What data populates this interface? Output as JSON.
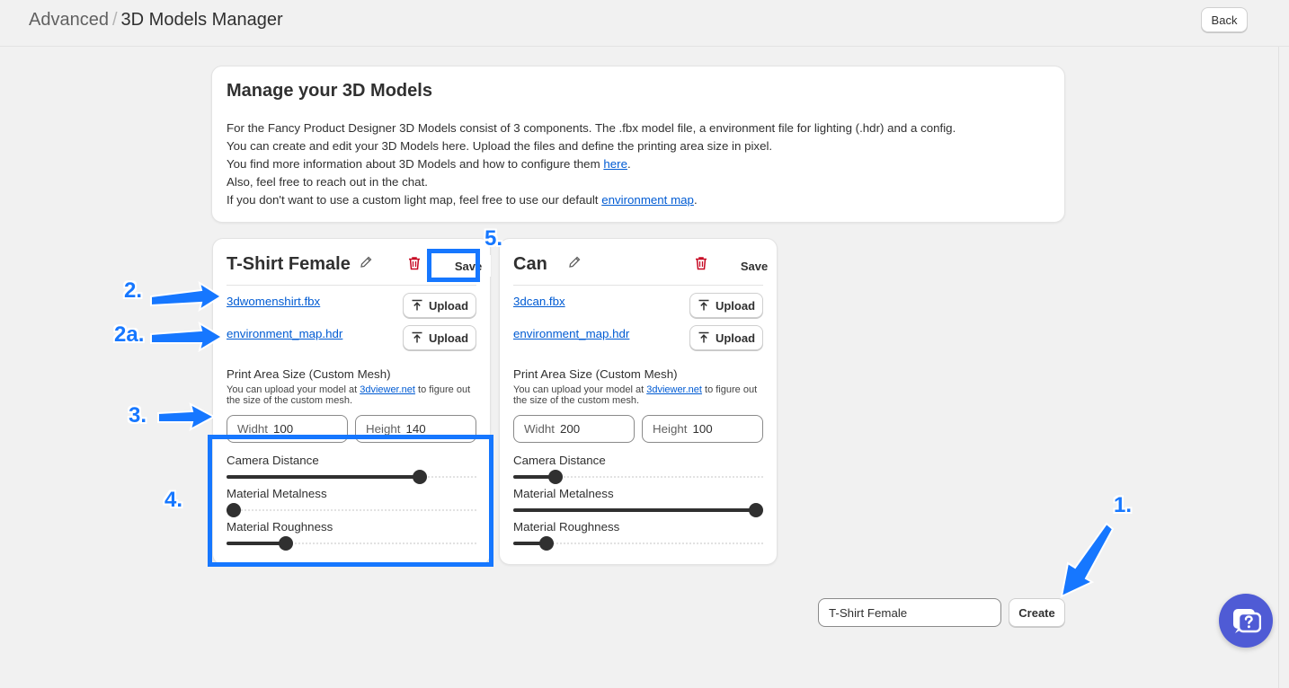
{
  "header": {
    "breadcrumb_parent": "Advanced",
    "breadcrumb_sep": "/",
    "breadcrumb_current": "3D Models Manager",
    "back_label": "Back"
  },
  "intro": {
    "title": "Manage your 3D Models",
    "line1": "For the Fancy Product Designer 3D Models consist of 3 components. The .fbx model file, a environment file for lighting (.hdr) and a config.",
    "line2": "You can create and edit your 3D Models here. Upload the files and define the printing area size in pixel.",
    "line3_pre": "You find more information about 3D Models and how to configure them ",
    "line3_link": "here",
    "line3_post": ".",
    "line4": "Also, feel free to reach out in the chat.",
    "line5_pre": "If you don't want to use a custom light map, feel free to use our default ",
    "line5_link": "environment map",
    "line5_post": "."
  },
  "models": [
    {
      "title": "T-Shirt Female",
      "save_label": "Save",
      "model_file": "3dwomenshirt.fbx",
      "env_file": "environment_map.hdr",
      "upload_label": "Upload",
      "print_area_label": "Print Area Size (Custom Mesh)",
      "hint_pre": "You can upload your model at ",
      "hint_link": "3dviewer.net",
      "hint_post": " to figure out the size of the custom mesh.",
      "width_label": "Widht",
      "width_value": "100",
      "height_label": "Height",
      "height_value": "140",
      "camera_label": "Camera Distance",
      "camera_value": 0.79,
      "metalness_label": "Material Metalness",
      "metalness_value": 0.0,
      "roughness_label": "Material Roughness",
      "roughness_value": 0.22
    },
    {
      "title": "Can",
      "save_label": "Save",
      "model_file": "3dcan.fbx",
      "env_file": "environment_map.hdr",
      "upload_label": "Upload",
      "print_area_label": "Print Area Size (Custom Mesh)",
      "hint_pre": "You can upload your model at ",
      "hint_link": "3dviewer.net",
      "hint_post": " to figure out the size of the custom mesh.",
      "width_label": "Widht",
      "width_value": "200",
      "height_label": "Height",
      "height_value": "100",
      "camera_label": "Camera Distance",
      "camera_value": 0.15,
      "metalness_label": "Material Metalness",
      "metalness_value": 1.0,
      "roughness_label": "Material Roughness",
      "roughness_value": 0.11
    }
  ],
  "create": {
    "input_value": "T-Shirt Female",
    "button_label": "Create"
  },
  "annotations": {
    "a1": "1.",
    "a2": "2.",
    "a2a": "2a.",
    "a3": "3.",
    "a4": "4.",
    "a5": "5.",
    "color": "#1677ff"
  },
  "icons": {
    "edit": "pencil-icon",
    "delete": "trash-icon",
    "upload": "upload-icon",
    "chat": "chat-help-icon"
  },
  "colors": {
    "link": "#005bd3",
    "delete": "#c70a24",
    "chat": "#4f5bd5"
  }
}
